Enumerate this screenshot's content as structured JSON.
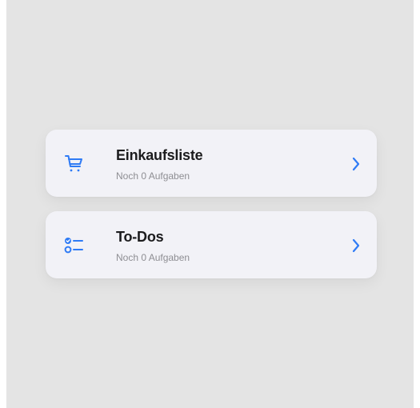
{
  "colors": {
    "accent": "#2f7bf5",
    "card_background": "#f2f2f7",
    "screen_background": "#e4e4e4",
    "title_text": "#1c1c1e",
    "subtitle_text": "#8e8e93"
  },
  "lists": [
    {
      "icon": "cart-icon",
      "title": "Einkaufsliste",
      "subtitle": "Noch 0 Aufgaben"
    },
    {
      "icon": "checklist-icon",
      "title": "To-Dos",
      "subtitle": "Noch 0 Aufgaben"
    }
  ]
}
